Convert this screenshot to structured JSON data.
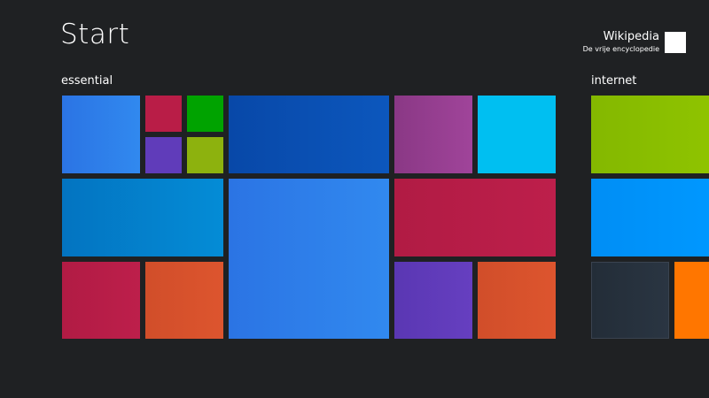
{
  "screen": {
    "title": "Start"
  },
  "user": {
    "name": "Wikipedia",
    "subtitle": "De vrije encyclopedie"
  },
  "groups": [
    {
      "label": "essential"
    },
    {
      "label": "internet"
    }
  ],
  "colors": {
    "background": "#1f2123",
    "blue": "#2d7fec",
    "crimson": "#b91d47",
    "green": "#00a300",
    "purple": "#603cba",
    "lime": "#8db20e",
    "dark_blue": "#0a4eb2",
    "magenta": "#9b3d92",
    "cyan": "#00bff1",
    "sky": "#0383cd",
    "orange": "#da532c",
    "bright_green": "#8bc000",
    "azure": "#0095ff",
    "slate": "#26313d",
    "amber": "#ff7600"
  }
}
